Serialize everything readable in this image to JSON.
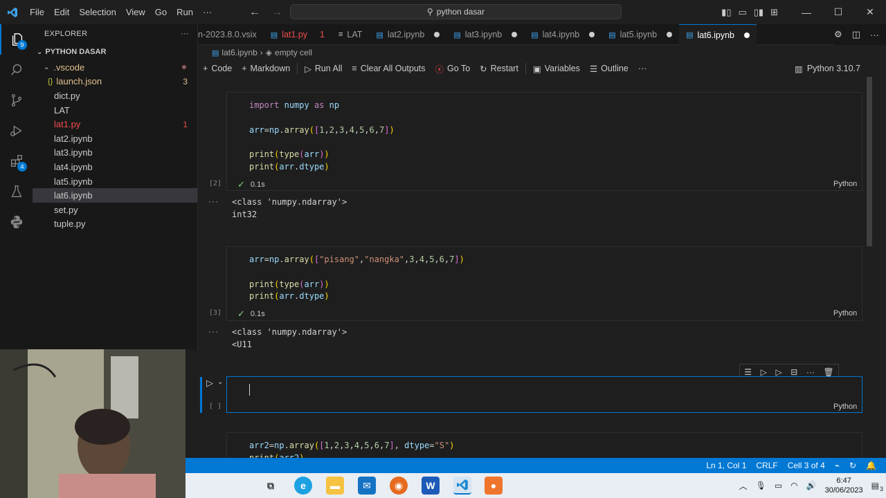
{
  "titlebar": {
    "menu": [
      "File",
      "Edit",
      "Selection",
      "View",
      "Go",
      "Run",
      "···"
    ],
    "search": "python dasar"
  },
  "activity": {
    "explorer_badge": "9",
    "extensions_badge": "4"
  },
  "sidebar": {
    "title": "EXPLORER",
    "folder": "PYTHON DASAR",
    "items": [
      {
        "label": ".vscode",
        "indent": 1,
        "color": "#e2c08d",
        "count": "",
        "twisty": "⌄",
        "dot": true
      },
      {
        "label": "launch.json",
        "indent": 2,
        "color": "#e2c08d",
        "count": "3",
        "icon": "{}"
      },
      {
        "label": "dict.py",
        "indent": 1,
        "color": "#cccccc",
        "count": ""
      },
      {
        "label": "LAT",
        "indent": 1,
        "color": "#cccccc",
        "count": ""
      },
      {
        "label": "lat1.py",
        "indent": 1,
        "color": "#f14c4c",
        "count": "1"
      },
      {
        "label": "lat2.ipynb",
        "indent": 1,
        "color": "#cccccc",
        "count": ""
      },
      {
        "label": "lat3.ipynb",
        "indent": 1,
        "color": "#cccccc",
        "count": ""
      },
      {
        "label": "lat4.ipynb",
        "indent": 1,
        "color": "#cccccc",
        "count": ""
      },
      {
        "label": "lat5.ipynb",
        "indent": 1,
        "color": "#cccccc",
        "count": ""
      },
      {
        "label": "lat6.ipynb",
        "indent": 1,
        "color": "#cccccc",
        "count": "",
        "selected": true
      },
      {
        "label": "set.py",
        "indent": 1,
        "color": "#cccccc",
        "count": ""
      },
      {
        "label": "tuple.py",
        "indent": 1,
        "color": "#cccccc",
        "count": ""
      }
    ]
  },
  "tabs": [
    {
      "label": "n-2023.8.0.vsix",
      "badge": "",
      "color": "#9d9d9d",
      "dot": false
    },
    {
      "label": "lat1.py",
      "badge": "1",
      "color": "#f14c4c",
      "dot": false
    },
    {
      "label": "LAT",
      "badge": "",
      "color": "#9d9d9d",
      "dot": false
    },
    {
      "label": "lat2.ipynb",
      "badge": "",
      "color": "#9d9d9d",
      "dot": true
    },
    {
      "label": "lat3.ipynb",
      "badge": "",
      "color": "#9d9d9d",
      "dot": true
    },
    {
      "label": "lat4.ipynb",
      "badge": "",
      "color": "#9d9d9d",
      "dot": true
    },
    {
      "label": "lat5.ipynb",
      "badge": "",
      "color": "#9d9d9d",
      "dot": true
    },
    {
      "label": "lat6.ipynb",
      "badge": "",
      "color": "#ffffff",
      "dot": true,
      "active": true
    }
  ],
  "breadcrumb": {
    "file": "lat6.ipynb",
    "cell": "empty cell"
  },
  "toolbar": {
    "code": "Code",
    "markdown": "Markdown",
    "run_all": "Run All",
    "clear": "Clear All Outputs",
    "goto": "Go To",
    "restart": "Restart",
    "variables": "Variables",
    "outline": "Outline",
    "more": "···",
    "kernel": "Python 3.10.7"
  },
  "cells": {
    "c2": {
      "num": "[2]",
      "time": "0.1s",
      "lang": "Python",
      "out1": "<class 'numpy.ndarray'>",
      "out2": "int32"
    },
    "c3": {
      "num": "[3]",
      "time": "0.1s",
      "lang": "Python",
      "out1": "<class 'numpy.ndarray'>",
      "out2": "<U11"
    },
    "c4": {
      "num": "[ ]",
      "lang": "Python"
    }
  },
  "status": {
    "position": "Ln 1, Col 1",
    "eol": "CRLF",
    "cell": "Cell 3 of 4"
  },
  "taskbar": {
    "time": "6:47",
    "date": "30/06/2023",
    "notif": "3"
  },
  "colors": {
    "accent": "#0078d4",
    "status_bar": "#0078d4",
    "error": "#f14c4c",
    "success": "#89d185"
  }
}
